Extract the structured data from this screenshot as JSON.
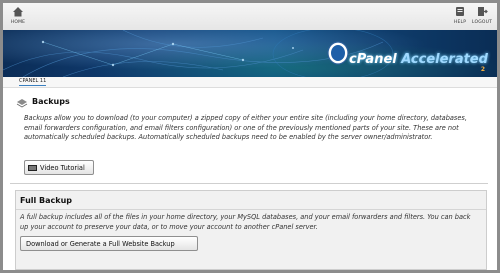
{
  "toolbar": {
    "home_label": "HOME",
    "help_label": "HELP",
    "logout_label": "LOGOUT"
  },
  "banner": {
    "brand_c": "c",
    "brand_panel": "Panel",
    "brand_accelerated": "Accelerated",
    "brand_version": "2"
  },
  "breadcrumb": {
    "label": "CPANEL 11"
  },
  "backups": {
    "title": "Backups",
    "description": "Backups allow you to download (to your computer) a zipped copy of either your entire site (including your home directory, databases, email forwarders configuration, and email filters configuration) or one of the previously mentioned parts of your site. These are not automatically scheduled backups. Automatically scheduled backups need to be enabled by the server owner/administrator.",
    "video_button": "Video Tutorial"
  },
  "full_backup": {
    "title": "Full Backup",
    "description": "A full backup includes all of the files in your home directory, your MySQL databases, and your email forwarders and filters. You can back up your account to preserve your data, or to move your account to another cPanel server.",
    "button": "Download or Generate a Full Website Backup"
  },
  "colors": {
    "banner_dark": "#0b2d57",
    "panel_bg": "#f1f1f1",
    "accent_blue": "#3a7fbf"
  },
  "icons": [
    "home-icon",
    "help-icon",
    "logout-icon",
    "backup-icon",
    "video-icon",
    "cpanel-logo"
  ]
}
